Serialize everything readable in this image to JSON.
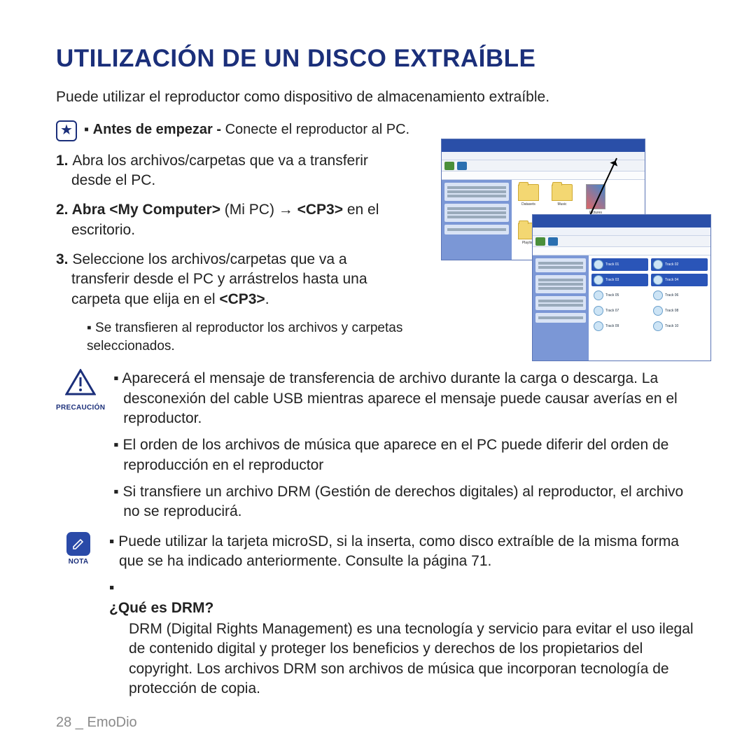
{
  "title": "UTILIZACIÓN DE UN DISCO EXTRAÍBLE",
  "intro": "Puede utilizar el reproductor como dispositivo de almacenamiento extraíble.",
  "before": {
    "bold": "Antes de empezar - ",
    "rest": "Conecte el reproductor al PC."
  },
  "steps": {
    "s1_num": "1. ",
    "s1": "Abra los archivos/carpetas que va a transferir desde el PC.",
    "s2_num": "2. ",
    "s2a": "Abra ",
    "s2b": "<My Computer>",
    "s2c": " (Mi PC) → ",
    "s2d": "<CP3>",
    "s2e": " en el escritorio.",
    "s3_num": "3. ",
    "s3a": "Seleccione los archivos/carpetas que va a transferir desde el PC y arrástrelos hasta una carpeta que elija en el ",
    "s3b": "<CP3>",
    "s3c": "."
  },
  "sub1": "Se transfieren al reproductor los archivos y carpetas seleccionados.",
  "caution_label": "PRECAUCIÓN",
  "caution": [
    "Aparecerá el mensaje de transferencia de archivo durante la carga o descarga. La desconexión del cable USB mientras aparece el mensaje puede causar averías en el reproductor.",
    "El orden de los archivos de música que aparece en el PC puede diferir del orden de reproducción en el reproductor",
    "Si transfiere un archivo DRM (Gestión de derechos digitales) al reproductor, el archivo no se reproducirá."
  ],
  "note_label": "NOTA",
  "note1": "Puede utilizar la tarjeta microSD, si la inserta, como disco extraíble de la misma forma que se ha indicado anteriormente. Consulte la página 71.",
  "drm_q": "¿Qué es DRM?",
  "drm_a": "DRM (Digital Rights Management) es una tecnología y servicio para evitar el uso ilegal de contenido digital y proteger los beneficios y derechos de los propietarios del copyright. Los archivos DRM son archivos de música que incorporan tecnología de protección de copia.",
  "footer": {
    "page": "28",
    "sep": " _ ",
    "section": "EmoDio"
  },
  "screenshot": {
    "folders": [
      "Datasets",
      "Music",
      "Pictures"
    ],
    "folder2": "Playlists"
  }
}
